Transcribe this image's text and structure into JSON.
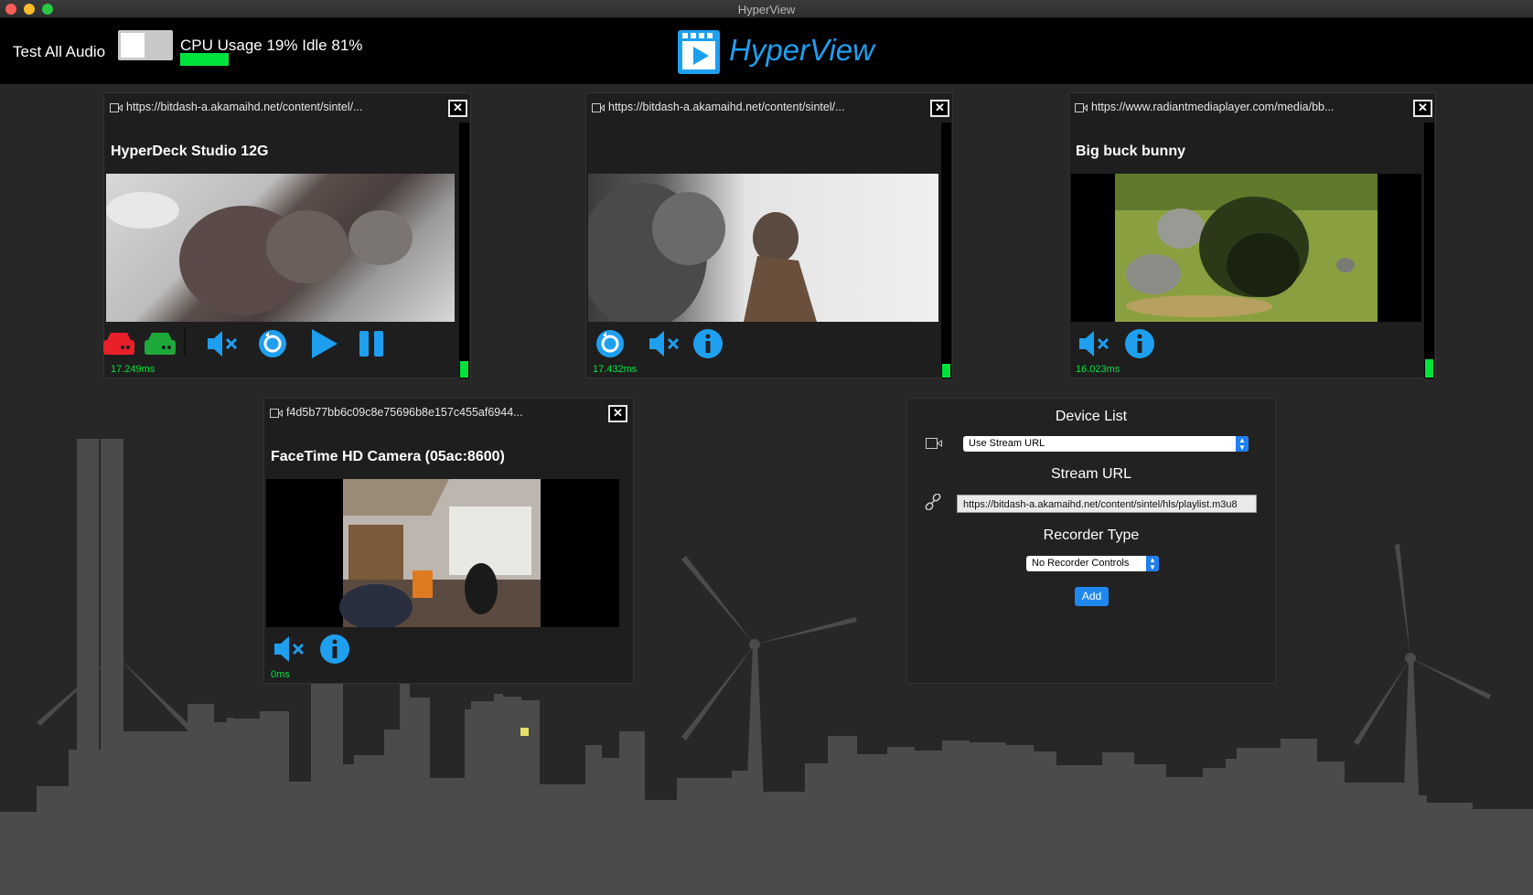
{
  "window": {
    "title": "HyperView"
  },
  "topbar": {
    "test_audio_label": "Test All Audio",
    "cpu_label": "CPU Usage 19% Idle 81%",
    "cpu_usage_fraction": 0.19,
    "logo_text": "HyperView"
  },
  "panels": [
    {
      "url": "https://bitdash-a.akamaihd.net/content/sintel/...",
      "title": "HyperDeck Studio 12G",
      "latency": "17.249ms",
      "controls": [
        "record-red-icon",
        "record-green-icon",
        "mute-icon",
        "loop-icon",
        "play-icon",
        "pause-icon"
      ],
      "meter_level": 0.07
    },
    {
      "url": "https://bitdash-a.akamaihd.net/content/sintel/...",
      "title": "",
      "latency": "17.432ms",
      "controls": [
        "loop-icon",
        "mute-icon",
        "info-icon"
      ],
      "meter_level": 0.06
    },
    {
      "url": "https://www.radiantmediaplayer.com/media/bb...",
      "title": "Big buck bunny",
      "latency": "16.023ms",
      "controls": [
        "mute-icon",
        "info-icon"
      ],
      "meter_level": 0.08
    },
    {
      "url": "f4d5b77bb6c09c8e75696b8e157c455af6944...",
      "title": "FaceTime HD Camera (05ac:8600)",
      "latency": "0ms",
      "controls": [
        "mute-icon",
        "info-icon"
      ]
    }
  ],
  "device_list": {
    "heading": "Device List",
    "device_select": "Use Stream URL",
    "stream_url_heading": "Stream URL",
    "stream_url_value": "https://bitdash-a.akamaihd.net/content/sintel/hls/playlist.m3u8",
    "recorder_heading": "Recorder Type",
    "recorder_select": "No Recorder Controls",
    "add_label": "Add"
  },
  "colors": {
    "accent": "#1e9ff0",
    "meter_green": "#00e33c",
    "record_red": "#e8202a",
    "record_green": "#1fa83a"
  }
}
